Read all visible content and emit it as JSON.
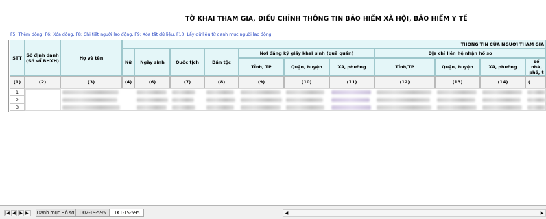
{
  "sheet": {
    "title": "TỜ KHAI THAM GIA, ĐIỀU CHỈNH THÔNG TIN BẢO HIỂM XÃ HỘI, BẢO HIỂM Y TẾ",
    "hint": "F5: Thêm dòng, F6: Xóa dòng, F8: Chi tiết người lao động, F9: Xóa tất dữ liệu, F10: Lấy dữ liệu từ danh mục người lao động"
  },
  "header": {
    "stt": "STT",
    "so_dinh_danh": "Số định danh (Số sổ BHXH)",
    "ho_va_ten": "Họ và tên",
    "thong_tin_group": "THÔNG TIN CỦA NGƯỜI THAM GIA",
    "nu": "Nữ",
    "ngay_sinh": "Ngày sinh",
    "quoc_tich": "Quốc tịch",
    "dan_toc": "Dân tộc",
    "noi_dang_ky_group": "Nơi đăng ký giấy khai sinh (quê quán)",
    "tinh_tp": "Tỉnh, TP",
    "quan_huyen": "Quận, huyện",
    "xa_phuong": "Xã, phường",
    "dia_chi_group": "Địa chỉ liên hệ nhận hồ sơ",
    "tinh_tp2": "Tỉnh/TP",
    "quan_huyen2": "Quận, huyện",
    "xa_phuong2": "Xã, phường",
    "so_nha": "Số nhà, phố, t"
  },
  "column_numbers": [
    "(1)",
    "(2)",
    "(3)",
    "(4)",
    "(6)",
    "(7)",
    "(8)",
    "(9)",
    "(10)",
    "(11)",
    "(12)",
    "(13)",
    "(14)",
    "("
  ],
  "rows": [
    "1",
    "2",
    "3"
  ],
  "tabs": {
    "tab1": "Danh mục Hồ sơ",
    "tab2": "D02-TS-595",
    "tab3": "TK1-TS-595"
  },
  "nav": {
    "first": "|◀",
    "prev": "◀",
    "next": "▶",
    "last": "▶|"
  }
}
